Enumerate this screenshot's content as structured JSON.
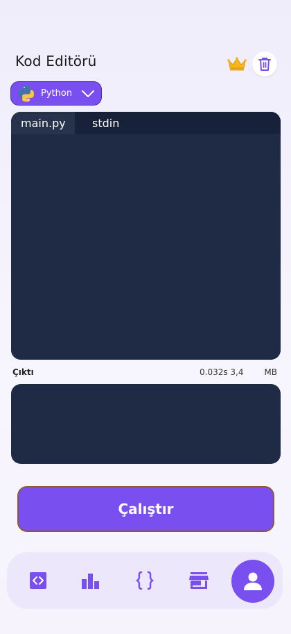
{
  "header": {
    "title": "Kod Editörü",
    "crown_icon": "crown-icon",
    "trash_icon": "trash-icon"
  },
  "language_selector": {
    "selected": "Python",
    "icon": "python-logo-icon"
  },
  "editor": {
    "tabs": [
      {
        "label": "main.py",
        "active": true
      },
      {
        "label": "stdin",
        "active": false
      }
    ],
    "code": ""
  },
  "output": {
    "label": "Çıktı",
    "stats": "0.032s 3,4",
    "unit": "MB",
    "text": ""
  },
  "run_button": {
    "label": "Çalıştır"
  },
  "bottom_nav": {
    "items": [
      {
        "icon": "code-editor-icon"
      },
      {
        "icon": "bar-chart-icon"
      },
      {
        "icon": "curly-braces-icon"
      },
      {
        "icon": "store-icon"
      },
      {
        "icon": "profile-icon",
        "active": true
      }
    ]
  },
  "colors": {
    "accent": "#7a4ff0",
    "editor_bg": "#1f2a44",
    "nav_bg": "#ece7fb"
  }
}
